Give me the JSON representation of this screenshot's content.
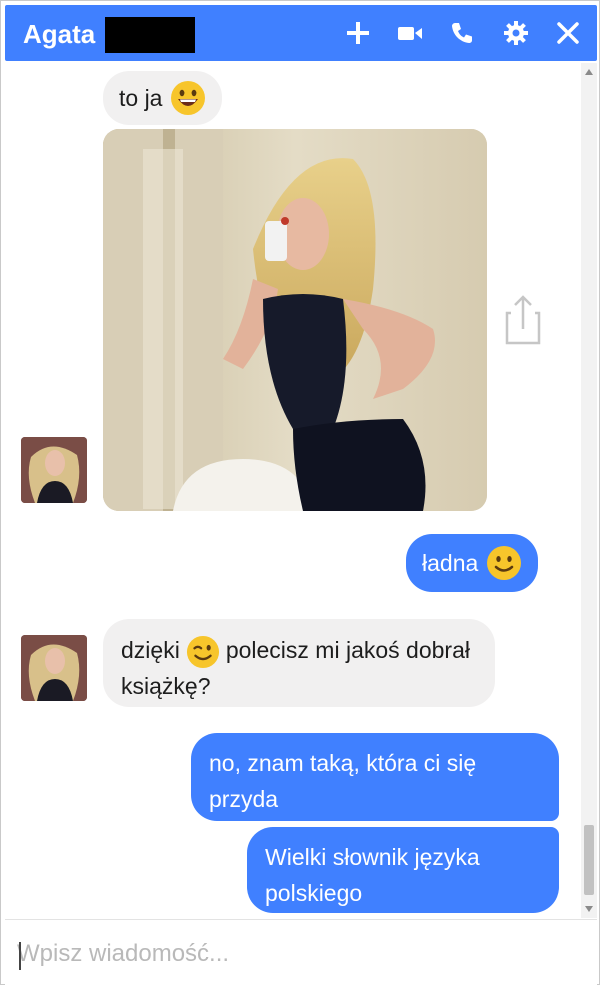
{
  "header": {
    "contact_name": "Agata",
    "bg_color": "#4080ff"
  },
  "icons": {
    "add": "plus-icon",
    "video": "video-camera-icon",
    "call": "phone-icon",
    "settings": "gear-icon",
    "close": "close-icon",
    "share": "share-icon"
  },
  "messages": [
    {
      "from": "contact",
      "text": "to ja",
      "emoji": "grinning"
    },
    {
      "from": "contact",
      "type": "photo"
    },
    {
      "from": "me",
      "text": "ładna",
      "emoji": "smiling"
    },
    {
      "from": "contact",
      "text_before": "dzięki",
      "emoji": "winking",
      "text_after": "polecisz mi jakoś dobrał książkę?"
    },
    {
      "from": "me",
      "text": "no, znam taką, która ci się przyda"
    },
    {
      "from": "me",
      "text": "Wielki słownik języka polskiego"
    }
  ],
  "composer": {
    "placeholder": "Wpisz wiadomość..."
  }
}
